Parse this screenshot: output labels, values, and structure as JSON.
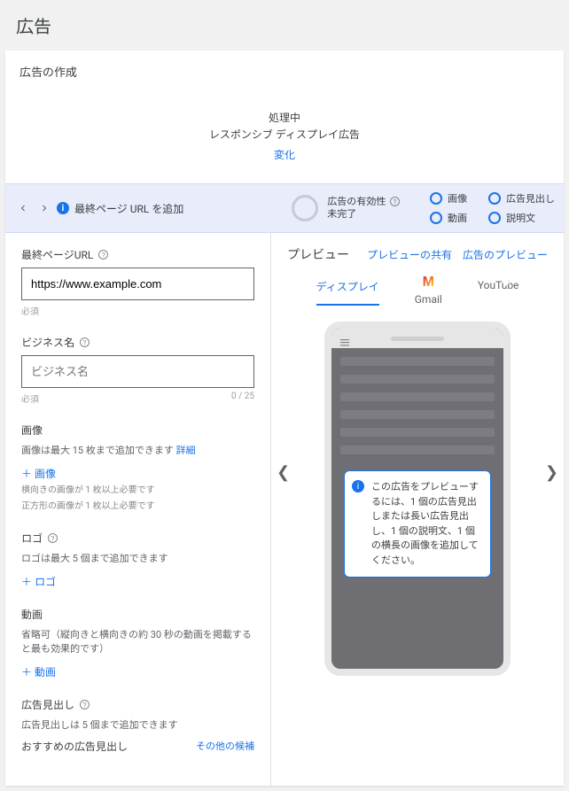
{
  "page": {
    "title": "広告"
  },
  "card": {
    "title": "広告の作成"
  },
  "status": {
    "line1": "処理中",
    "line2": "レスポンシブ ディスプレイ広告",
    "link": "変化"
  },
  "stepbar": {
    "info_glyph": "i",
    "step_text": "最終ページ URL を追加",
    "strength_label": "広告の有効性",
    "strength_value": "未完了",
    "assets": [
      "画像",
      "広告見出し",
      "動画",
      "説明文"
    ]
  },
  "form": {
    "final_url": {
      "label": "最終ページURL",
      "value": "https://www.example.com",
      "required": "必須"
    },
    "business": {
      "label": "ビジネス名",
      "placeholder": "ビジネス名",
      "required": "必須",
      "counter": "0 / 25"
    },
    "images": {
      "label": "画像",
      "sub": "画像は最大 15 枚まで追加できます",
      "detail": "詳細",
      "add": "＋ 画像",
      "note1": "横向きの画像が 1 枚以上必要です",
      "note2": "正方形の画像が 1 枚以上必要です"
    },
    "logo": {
      "label": "ロゴ",
      "sub": "ロゴは最大 5 個まで追加できます",
      "add": "＋ ロゴ"
    },
    "video": {
      "label": "動画",
      "sub": "省略可（縦向きと横向きの約 30 秒の動画を掲載すると最も効果的です）",
      "add": "＋ 動画"
    },
    "headline": {
      "label": "広告見出し",
      "sub": "広告見出しは 5 個まで追加できます",
      "suggested": "おすすめの広告見出し",
      "other": "その他の候補"
    }
  },
  "preview": {
    "title": "プレビュー",
    "share": "プレビューの共有",
    "ad_preview": "広告のプレビュー",
    "tabs": {
      "display": "ディスプレイ",
      "gmail": "Gmail",
      "youtube": "YouTube"
    },
    "callout": "この広告をプレビューするには、1 個の広告見出しまたは長い広告見出し、1 個の説明文、1 個の横長の画像を追加してください。",
    "callout_glyph": "i"
  }
}
